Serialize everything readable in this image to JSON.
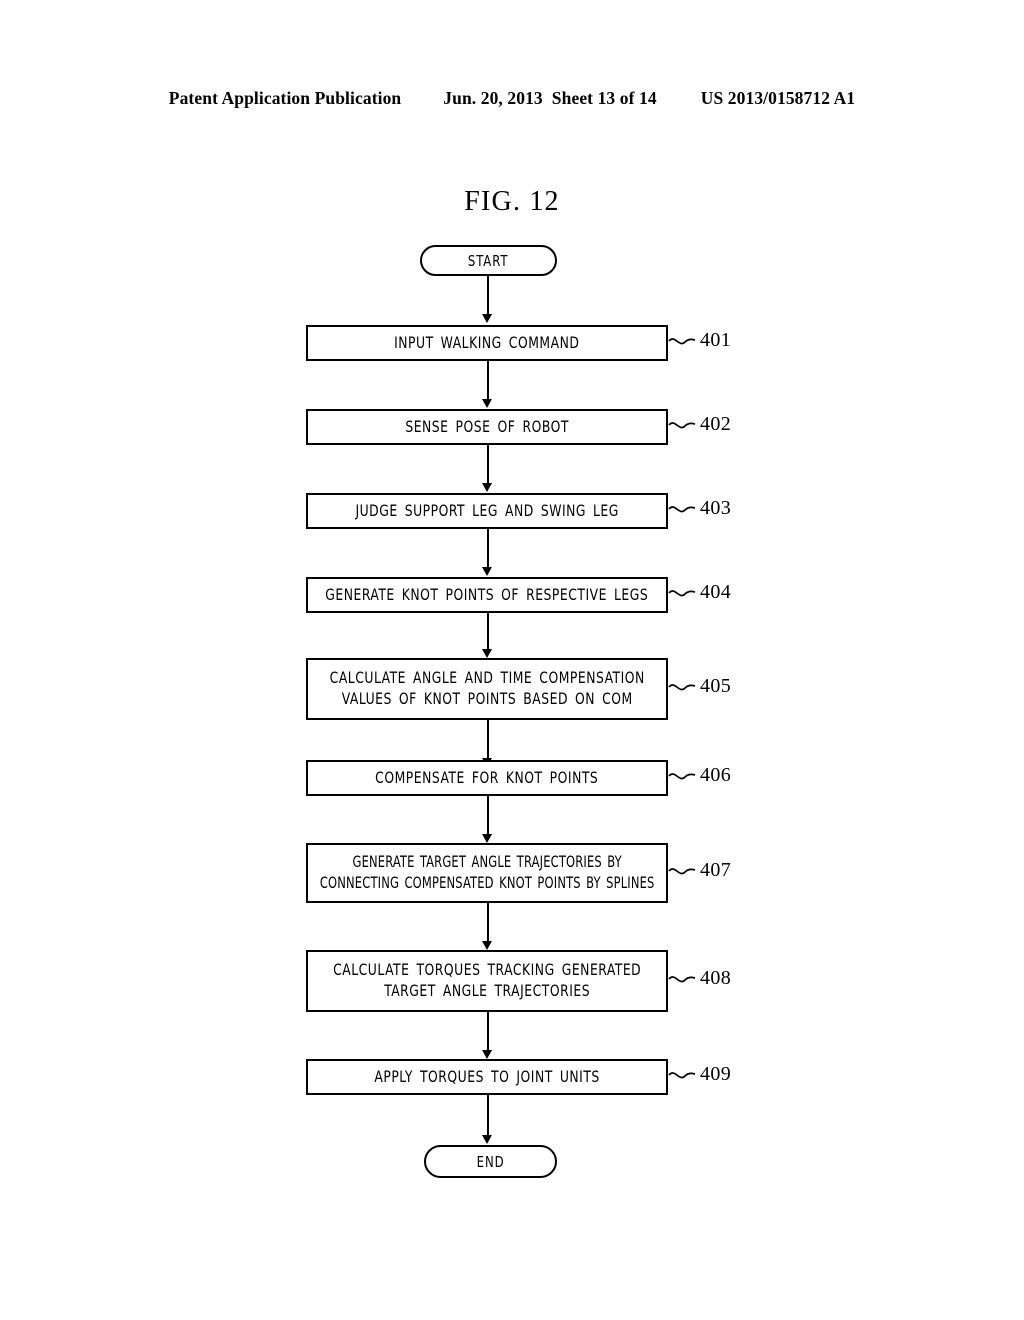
{
  "header": {
    "publication": "Patent Application Publication",
    "date": "Jun. 20, 2013",
    "sheet": "Sheet 13 of 14",
    "doc_number": "US 2013/0158712 A1"
  },
  "figure": {
    "title": "FIG. 12"
  },
  "flowchart": {
    "start_label": "START",
    "end_label": "END",
    "steps": [
      {
        "ref": "401",
        "text": "INPUT WALKING COMMAND"
      },
      {
        "ref": "402",
        "text": "SENSE POSE OF ROBOT"
      },
      {
        "ref": "403",
        "text": "JUDGE SUPPORT LEG AND SWING LEG"
      },
      {
        "ref": "404",
        "text": "GENERATE KNOT POINTS OF RESPECTIVE LEGS"
      },
      {
        "ref": "405",
        "text": "CALCULATE ANGLE AND TIME COMPENSATION\nVALUES OF KNOT POINTS BASED ON COM"
      },
      {
        "ref": "406",
        "text": "COMPENSATE FOR KNOT POINTS"
      },
      {
        "ref": "407",
        "text": "GENERATE TARGET ANGLE TRAJECTORIES BY\nCONNECTING COMPENSATED KNOT POINTS BY SPLINES"
      },
      {
        "ref": "408",
        "text": "CALCULATE TORQUES TRACKING GENERATED\nTARGET ANGLE TRAJECTORIES"
      },
      {
        "ref": "409",
        "text": "APPLY TORQUES TO JOINT UNITS"
      }
    ]
  },
  "colors": {
    "ink": "#000000",
    "paper": "#ffffff"
  }
}
